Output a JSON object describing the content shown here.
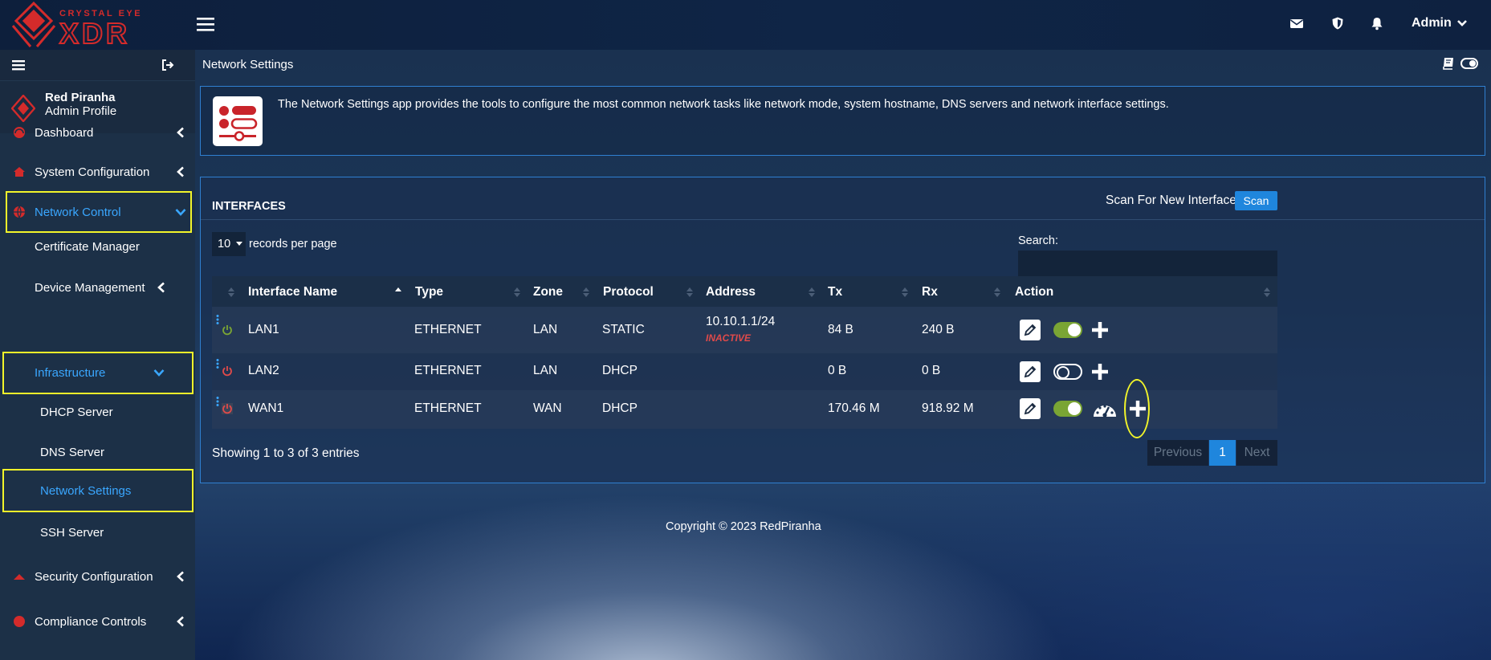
{
  "brand": {
    "logo_text_top": "CRYSTAL EYE",
    "logo_text_main": "XDR"
  },
  "topbar": {
    "admin_label": "Admin"
  },
  "sidebar": {
    "profile": {
      "name": "Red Piranha",
      "role": "Admin Profile"
    },
    "items": [
      {
        "label": "Dashboard"
      },
      {
        "label": "System Configuration"
      },
      {
        "label": "Network Control"
      },
      {
        "label": "Certificate Manager"
      },
      {
        "label": "Device Management"
      },
      {
        "label": "Infrastructure"
      },
      {
        "label": "DHCP Server"
      },
      {
        "label": "DNS Server"
      },
      {
        "label": "Network Settings"
      },
      {
        "label": "SSH Server"
      },
      {
        "label": "Security Configuration"
      },
      {
        "label": "Compliance Controls"
      }
    ]
  },
  "page": {
    "title": "Network Settings",
    "info_text": "The Network Settings app provides the tools to configure the most common network tasks like network mode, system hostname, DNS servers and network interface settings."
  },
  "interfaces": {
    "title": "INTERFACES",
    "scan_label": "Scan For New Interfaces",
    "scan_button": "Scan",
    "per_page_value": "10",
    "per_page_label": "records per page",
    "search_label": "Search:",
    "search_value": "",
    "columns": [
      "Interface Name",
      "Type",
      "Zone",
      "Protocol",
      "Address",
      "Tx",
      "Rx",
      "Action"
    ],
    "rows": [
      {
        "name": "LAN1",
        "type": "ETHERNET",
        "zone": "LAN",
        "protocol": "STATIC",
        "address": "10.10.1.1/24",
        "status": "INACTIVE",
        "tx": "84 B",
        "rx": "240 B",
        "enabled": true
      },
      {
        "name": "LAN2",
        "type": "ETHERNET",
        "zone": "LAN",
        "protocol": "DHCP",
        "address": "",
        "status": "",
        "tx": "0 B",
        "rx": "0 B",
        "enabled": false
      },
      {
        "name": "WAN1",
        "type": "ETHERNET",
        "zone": "WAN",
        "protocol": "DHCP",
        "address": "",
        "status": "",
        "tx": "170.46 M",
        "rx": "918.92 M",
        "enabled": true
      }
    ],
    "entries_info": "Showing 1 to 3 of 3 entries",
    "pagination": {
      "previous": "Previous",
      "current": "1",
      "next": "Next"
    }
  },
  "footer": {
    "copyright": "Copyright © 2023 RedPiranha"
  },
  "colors": {
    "accent_blue": "#1f86dd",
    "active_link": "#3aa7ff",
    "highlight_box": "#f2f52a",
    "brand_red": "#d42b2b",
    "toggle_on": "#7aa534",
    "inactive_red": "#e04a4a"
  },
  "icons": {
    "topbar": [
      "envelope-icon",
      "shield-icon",
      "bell-icon"
    ],
    "actions": [
      "edit-icon",
      "toggle-icon",
      "plus-icon",
      "gauge-icon"
    ]
  }
}
